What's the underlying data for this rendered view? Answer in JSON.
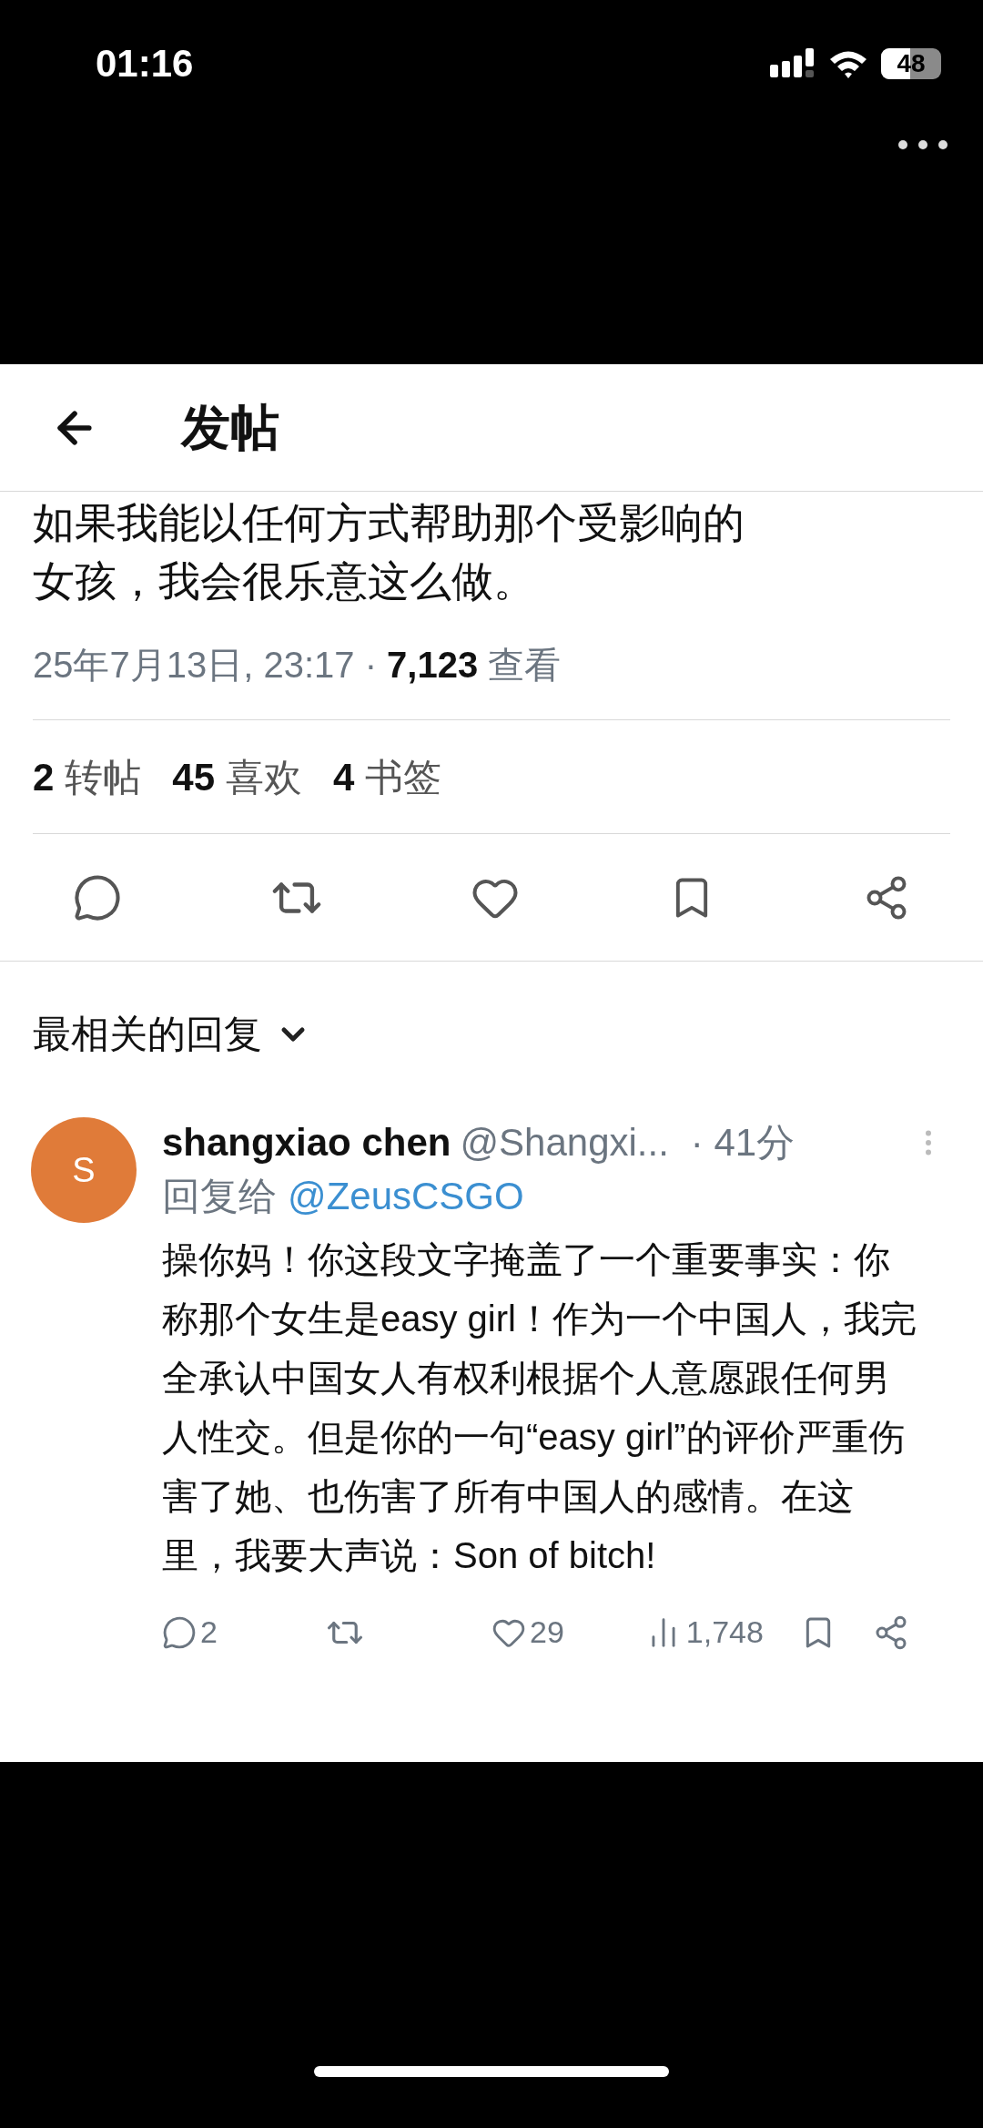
{
  "status_bar": {
    "time": "01:16",
    "battery": "48"
  },
  "header": {
    "title": "发帖"
  },
  "post": {
    "text_lines": [
      "如果我能以任何方式帮助那个受影响的",
      "女孩，我会很乐意这么做。"
    ],
    "date": "25年7月13日, 23:17 · ",
    "views": "7,123",
    "views_label": " 查看",
    "stats": [
      {
        "count": "2",
        "label": "转帖"
      },
      {
        "count": "45",
        "label": "喜欢"
      },
      {
        "count": "4",
        "label": "书签"
      }
    ]
  },
  "replies_sort": {
    "label": "最相关的回复"
  },
  "reply": {
    "avatar_letter": "S",
    "name": "shangxiao chen",
    "handle": "@Shangxi...",
    "time": "· 41分",
    "reply_to_label": "回复给",
    "reply_to": "@ZeusCSGO",
    "text": "操你妈！你这段文字掩盖了一个重要事实：你称那个女生是easy girl！作为一个中国人，我完全承认中国女人有权利根据个人意愿跟任何男人性交。但是你的一句“easy girl”的评价严重伤害了她、也伤害了所有中国人的感情。在这里，我要大声说：Son of bitch!",
    "replies": "2",
    "likes": "29",
    "views": "1,748"
  }
}
